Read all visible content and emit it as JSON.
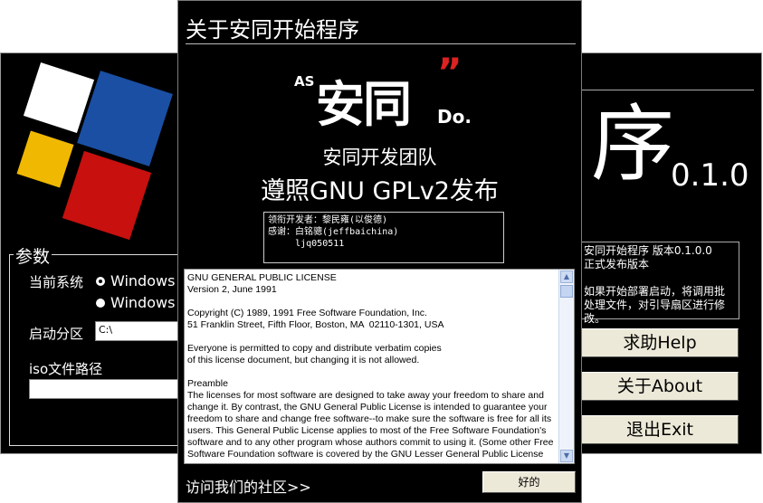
{
  "main_window": {
    "params_legend": "参数",
    "current_system_label": "当前系统",
    "radio_windows_1": "Windows",
    "radio_windows_2": "Windows",
    "boot_partition_label": "启动分区",
    "boot_partition_value": "C:\\",
    "iso_path_label": "iso文件路径",
    "iso_path_value": "",
    "title_char": "序",
    "version": "0.1.0",
    "info_lines": [
      "安同开始程序 版本0.1.0.0",
      "正式发布版本",
      "",
      "如果开始部署启动，将调用批",
      "处理文件，对引导扇区进行修",
      "改。"
    ],
    "help_button": "求助Help",
    "about_button": "关于About",
    "exit_button": "退出Exit"
  },
  "about_dialog": {
    "title": "关于安同开始程序",
    "brand_as": "AS",
    "brand_name": "安同",
    "brand_quote": "”",
    "brand_do": "Do.",
    "team": "安同开发团队",
    "license_line": "遵照GNU GPLv2发布",
    "credits": [
      "领衔开发者：黎民雍(以俊德)",
      "感谢：白铭骢(jeffbaichina)",
      "     ljq050511"
    ],
    "license_text": "GNU GENERAL PUBLIC LICENSE\nVersion 2, June 1991\n\nCopyright (C) 1989, 1991 Free Software Foundation, Inc.\n51 Franklin Street, Fifth Floor, Boston, MA  02110-1301, USA\n\nEveryone is permitted to copy and distribute verbatim copies\nof this license document, but changing it is not allowed.\n\nPreamble\nThe licenses for most software are designed to take away your freedom to share and change it. By contrast, the GNU General Public License is intended to guarantee your freedom to share and change free software--to make sure the software is free for all its users. This General Public License applies to most of the Free Software Foundation's software and to any other program whose authors commit to using it. (Some other Free Software Foundation software is covered by the GNU Lesser General Public License",
    "community_link": "访问我们的社区>>",
    "ok_button": "好的"
  },
  "colors": {
    "background": "#000000",
    "logo_white": "#ffffff",
    "logo_blue": "#1a4fa3",
    "logo_yellow": "#f0b800",
    "logo_red": "#c8100e",
    "button_face": "#ece9d8"
  }
}
